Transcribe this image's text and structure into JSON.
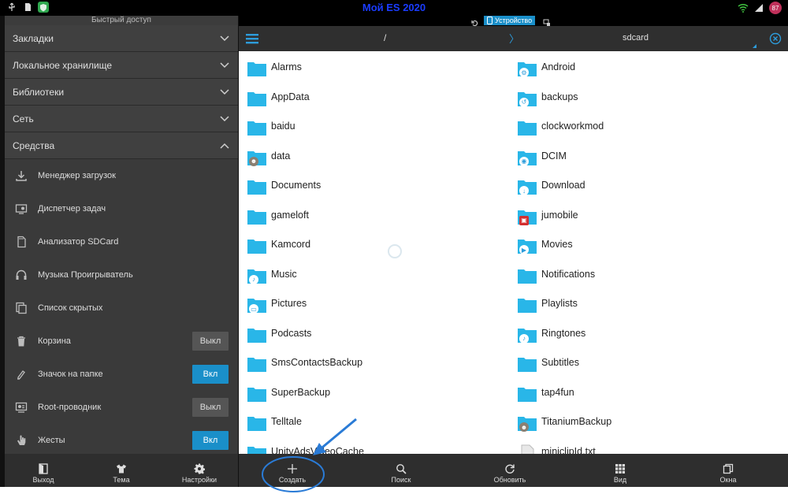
{
  "status_bar": {
    "center_text": "Мой ES 2020",
    "badge": "87"
  },
  "tab_row": {
    "device_label": "Устройство"
  },
  "sidebar": {
    "title": "Быстрый доступ",
    "sections": [
      {
        "label": "Закладки",
        "expanded": false
      },
      {
        "label": "Локальное хранилище",
        "expanded": false
      },
      {
        "label": "Библиотеки",
        "expanded": false
      },
      {
        "label": "Сеть",
        "expanded": false
      },
      {
        "label": "Средства",
        "expanded": true
      }
    ],
    "tools": [
      {
        "label": "Менеджер загрузок",
        "icon": "download-icon"
      },
      {
        "label": "Диспетчер задач",
        "icon": "task-manager-icon"
      },
      {
        "label": "Анализатор SDCard",
        "icon": "sdcard-icon"
      },
      {
        "label": "Музыка Проигрыватель",
        "icon": "headphones-icon"
      },
      {
        "label": "Список скрытых",
        "icon": "hidden-list-icon"
      },
      {
        "label": "Корзина",
        "icon": "trash-icon",
        "toggle": "Выкл",
        "on": false
      },
      {
        "label": "Значок на папке",
        "icon": "folder-badge-icon",
        "toggle": "Вкл",
        "on": true
      },
      {
        "label": "Root-проводник",
        "icon": "root-icon",
        "toggle": "Выкл",
        "on": false
      },
      {
        "label": "Жесты",
        "icon": "gesture-icon",
        "toggle": "Вкл",
        "on": true
      }
    ],
    "bottom_bar": [
      {
        "label": "Выход",
        "icon": "exit-icon"
      },
      {
        "label": "Тема",
        "icon": "theme-shirt-icon"
      },
      {
        "label": "Настройки",
        "icon": "gear-icon"
      }
    ]
  },
  "header": {
    "left_path": "/",
    "separator": "〉",
    "right_path": "sdcard"
  },
  "files": {
    "left": [
      {
        "name": "Alarms",
        "badge": ""
      },
      {
        "name": "AppData",
        "badge": ""
      },
      {
        "name": "baidu",
        "badge": ""
      },
      {
        "name": "data",
        "badge": "avatar"
      },
      {
        "name": "Documents",
        "badge": ""
      },
      {
        "name": "gameloft",
        "badge": ""
      },
      {
        "name": "Kamcord",
        "badge": ""
      },
      {
        "name": "Music",
        "badge": "music"
      },
      {
        "name": "Pictures",
        "badge": "picture"
      },
      {
        "name": "Podcasts",
        "badge": ""
      },
      {
        "name": "SmsContactsBackup",
        "badge": ""
      },
      {
        "name": "SuperBackup",
        "badge": ""
      },
      {
        "name": "Telltale",
        "badge": ""
      },
      {
        "name": "UnityAdsVideoCache",
        "badge": ""
      }
    ],
    "right": [
      {
        "name": "Android",
        "badge": "gear"
      },
      {
        "name": "backups",
        "badge": "backup"
      },
      {
        "name": "clockworkmod",
        "badge": ""
      },
      {
        "name": "DCIM",
        "badge": "camera"
      },
      {
        "name": "Download",
        "badge": "download"
      },
      {
        "name": "jumobile",
        "badge": "app"
      },
      {
        "name": "Movies",
        "badge": "movie"
      },
      {
        "name": "Notifications",
        "badge": ""
      },
      {
        "name": "Playlists",
        "badge": ""
      },
      {
        "name": "Ringtones",
        "badge": "music"
      },
      {
        "name": "Subtitles",
        "badge": ""
      },
      {
        "name": "tap4fun",
        "badge": ""
      },
      {
        "name": "TitaniumBackup",
        "badge": "avatar"
      },
      {
        "name": "miniclipId.txt",
        "badge": ""
      }
    ]
  },
  "main_bar": [
    {
      "label": "Создать",
      "icon": "plus-icon"
    },
    {
      "label": "Поиск",
      "icon": "search-icon"
    },
    {
      "label": "Обновить",
      "icon": "refresh-icon"
    },
    {
      "label": "Вид",
      "icon": "grid-view-icon"
    },
    {
      "label": "Окна",
      "icon": "windows-icon"
    }
  ],
  "colors": {
    "accent": "#1a8fc9",
    "folder": "#29b6e8",
    "annotation": "#2a7bd6"
  }
}
